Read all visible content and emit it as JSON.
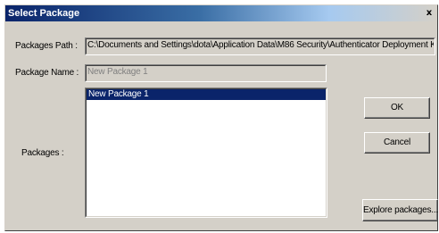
{
  "window": {
    "title": "Select Package",
    "close_glyph": "x"
  },
  "form": {
    "packages_path_label": "Packages Path :",
    "packages_path_value": "C:\\Documents and Settings\\dota\\Application Data\\M86 Security\\Authenticator Deployment Kit\\Pac",
    "package_name_label": "Package Name :",
    "package_name_value": "New Package 1",
    "packages_label": "Packages :"
  },
  "packages": {
    "items": [
      {
        "label": "New Package 1",
        "selected": true
      }
    ]
  },
  "buttons": {
    "ok": "OK",
    "cancel": "Cancel",
    "explore": "Explore packages..."
  },
  "colors": {
    "title_gradient_start": "#0a246a",
    "title_gradient_end": "#a6caf0",
    "selection": "#0a246a",
    "face": "#d4d0c8"
  }
}
